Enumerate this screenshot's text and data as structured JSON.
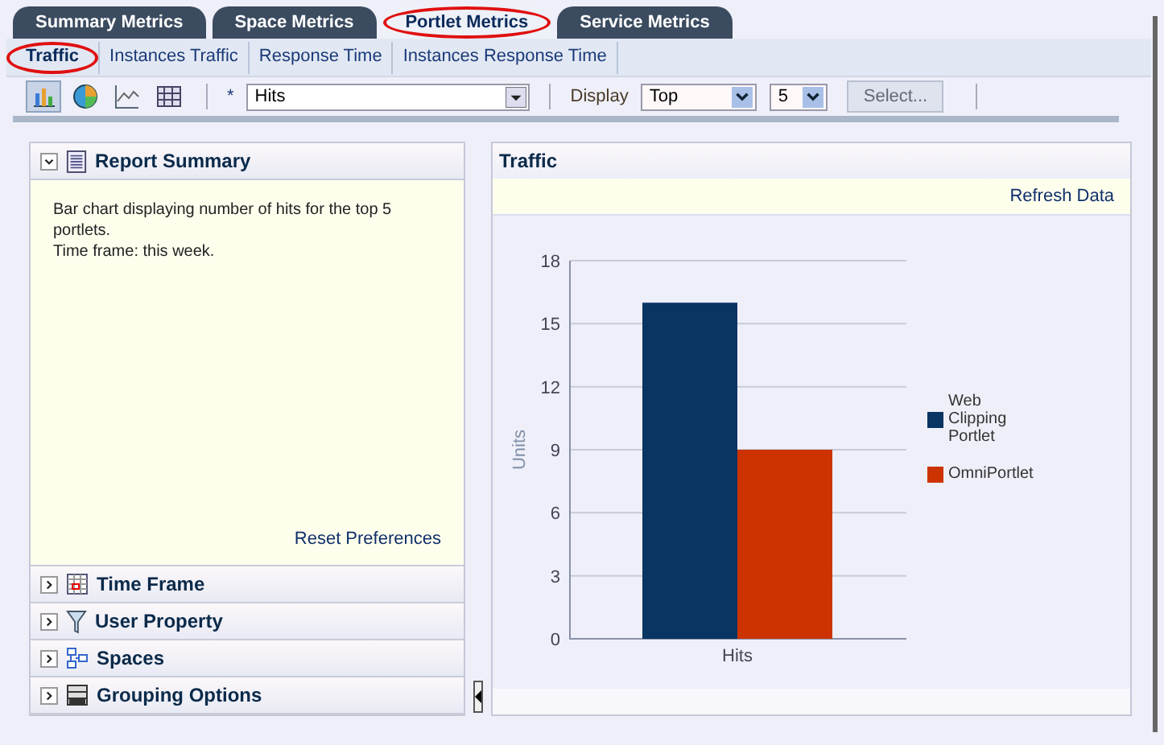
{
  "main_tabs": [
    {
      "label": "Summary Metrics",
      "selected": false,
      "circled": false
    },
    {
      "label": "Space Metrics",
      "selected": false,
      "circled": false
    },
    {
      "label": "Portlet Metrics",
      "selected": true,
      "circled": true
    },
    {
      "label": "Service Metrics",
      "selected": false,
      "circled": false
    }
  ],
  "sub_tabs": [
    {
      "label": "Traffic",
      "selected": true,
      "circled": true
    },
    {
      "label": "Instances Traffic",
      "selected": false,
      "circled": false
    },
    {
      "label": "Response Time",
      "selected": false,
      "circled": false
    },
    {
      "label": "Instances Response Time",
      "selected": false,
      "circled": false
    }
  ],
  "toolbar": {
    "views": [
      {
        "kind": "bar",
        "selected": true
      },
      {
        "kind": "pie",
        "selected": false
      },
      {
        "kind": "line",
        "selected": false
      },
      {
        "kind": "table",
        "selected": false
      }
    ],
    "required_mark": "*",
    "metric": "Hits",
    "display_label": "Display",
    "display_value": "Top",
    "count_value": "5",
    "select_button": "Select..."
  },
  "left_panel": {
    "sections": [
      {
        "title": "Report Summary",
        "kind": "summary",
        "expanded": true
      },
      {
        "title": "Time Frame",
        "kind": "calendar",
        "expanded": false
      },
      {
        "title": "User Property",
        "kind": "filter",
        "expanded": false
      },
      {
        "title": "Spaces",
        "kind": "spaces",
        "expanded": false
      },
      {
        "title": "Grouping Options",
        "kind": "grouping",
        "expanded": false
      }
    ],
    "summary_text": "Bar chart displaying number of hits for the top 5 portlets.",
    "time_frame_text": "Time frame: this week.",
    "reset_link": "Reset Preferences"
  },
  "right_panel": {
    "title": "Traffic",
    "refresh_link": "Refresh Data",
    "chart_data": {
      "type": "bar",
      "ylabel": "Units",
      "categories": [
        "Hits"
      ],
      "series": [
        {
          "name": "Web Clipping Portlet",
          "color": "#0a3462",
          "values": [
            16
          ]
        },
        {
          "name": "OmniPortlet",
          "color": "#cc3300",
          "values": [
            9
          ]
        }
      ],
      "ylim": [
        0,
        18
      ],
      "grid": true,
      "yticks": [
        0,
        3,
        6,
        9,
        12,
        15,
        18
      ]
    }
  }
}
